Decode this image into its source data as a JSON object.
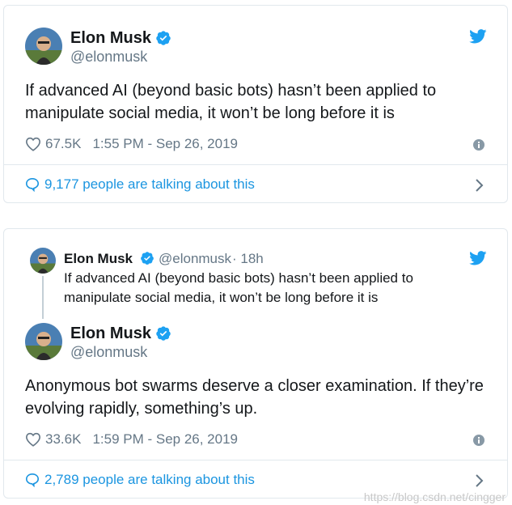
{
  "tweet1": {
    "author_name": "Elon Musk",
    "author_handle": "@elonmusk",
    "text": "If advanced AI (beyond basic bots) hasn’t been applied to manipulate social media, it won’t be long before it is",
    "likes": "67.5K",
    "timestamp": "1:55 PM - Sep 26, 2019",
    "talking": "9,177 people are talking about this"
  },
  "tweet2": {
    "quoted": {
      "author_name": "Elon Musk",
      "author_handle": "@elonmusk",
      "age": "· 18h",
      "text": "If advanced AI (beyond basic bots) hasn’t been applied to manipulate social media, it won’t be long before it is"
    },
    "author_name": "Elon Musk",
    "author_handle": "@elonmusk",
    "text": "Anonymous bot swarms deserve a closer examination. If they’re evolving rapidly, something’s up.",
    "likes": "33.6K",
    "timestamp": "1:59 PM - Sep 26, 2019",
    "talking": "2,789 people are talking about this"
  },
  "watermark": "https://blog.csdn.net/cingger",
  "icons": {
    "verified": "verified-badge-icon",
    "twitter": "twitter-bird-icon",
    "like": "heart-icon",
    "info": "info-icon",
    "talk": "speech-bubble-icon",
    "more": "chevron-right-icon"
  },
  "colors": {
    "twitter_blue": "#1da1f2",
    "link_blue": "#1b95e0",
    "secondary_text": "#657786",
    "border": "#e1e8ed"
  }
}
